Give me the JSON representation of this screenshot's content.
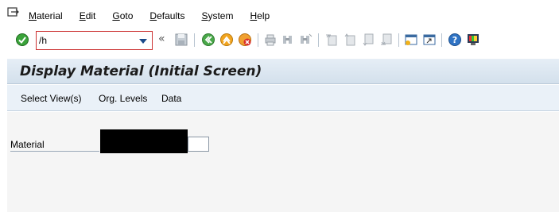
{
  "menu": {
    "items": [
      {
        "label": "Material",
        "underline": "M"
      },
      {
        "label": "Edit",
        "underline": "E"
      },
      {
        "label": "Goto",
        "underline": "G"
      },
      {
        "label": "Defaults",
        "underline": "D"
      },
      {
        "label": "System",
        "underline": "S"
      },
      {
        "label": "Help",
        "underline": "H"
      }
    ]
  },
  "toolbar": {
    "command_value": "/h",
    "icons": [
      "enter-icon",
      "save-icon",
      "back-icon",
      "exit-icon",
      "cancel-icon",
      "print-icon",
      "find-icon",
      "find-next-icon",
      "first-page-icon",
      "previous-page-icon",
      "next-page-icon",
      "last-page-icon",
      "create-session-icon",
      "generate-shortcut-icon",
      "help-icon",
      "customize-layout-icon"
    ]
  },
  "title": "Display Material (Initial Screen)",
  "app_toolbar": {
    "buttons": [
      "Select View(s)",
      "Org. Levels",
      "Data"
    ]
  },
  "form": {
    "material_label": "Material",
    "material_value": ""
  },
  "colors": {
    "accent": "#1a4a8a",
    "title_bg": "#dbe6f1",
    "work_bg": "#f5f5f5",
    "command_border": "#cc3333"
  }
}
